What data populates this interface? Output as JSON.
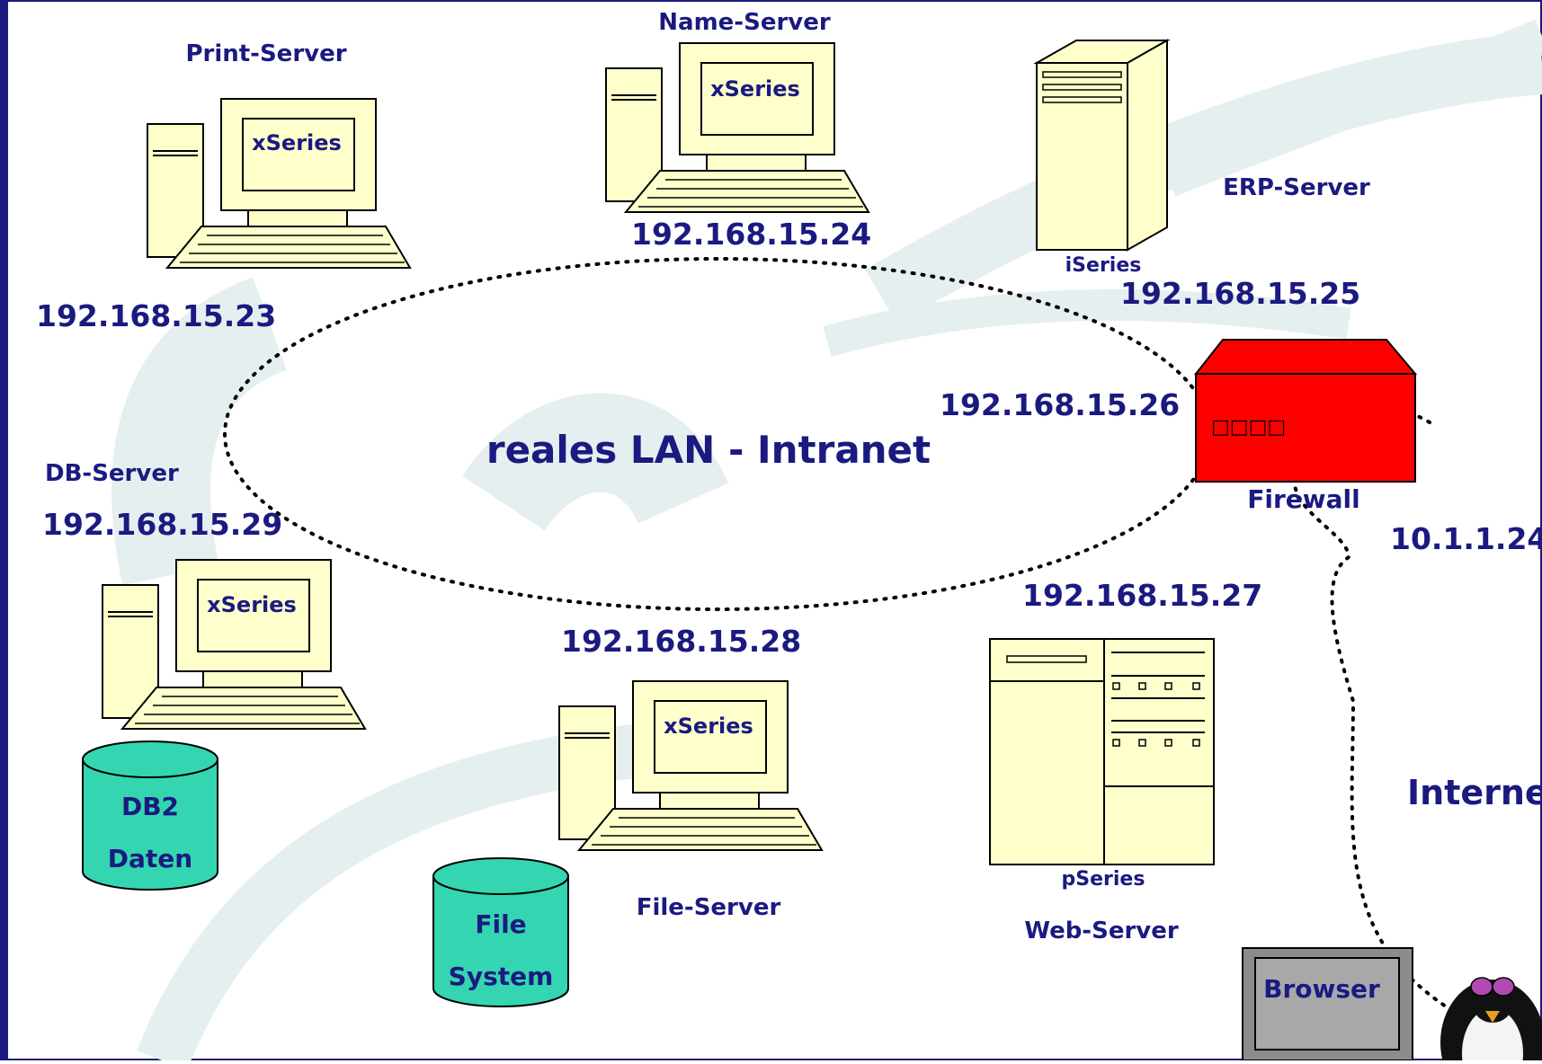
{
  "network": {
    "lan_label": "reales LAN - Intranet",
    "internet_label": "Interne",
    "external_ip": "10.1.1.24"
  },
  "nodes": {
    "print_server": {
      "role": "Print-Server",
      "series": "xSeries",
      "ip": "192.168.15.23"
    },
    "name_server": {
      "role": "Name-Server",
      "series": "xSeries",
      "ip": "192.168.15.24"
    },
    "erp_server": {
      "role": "ERP-Server",
      "series": "iSeries",
      "ip": "192.168.15.25"
    },
    "db_server": {
      "role": "DB-Server",
      "series": "xSeries",
      "ip": "192.168.15.29",
      "storage_line1": "DB2",
      "storage_line2": "Daten"
    },
    "file_server": {
      "role": "File-Server",
      "series": "xSeries",
      "ip": "192.168.15.28",
      "storage_line1": "File",
      "storage_line2": "System"
    },
    "web_server": {
      "role": "Web-Server",
      "series": "pSeries",
      "ip": "192.168.15.27"
    },
    "firewall": {
      "role": "Firewall",
      "ip": "192.168.15.26",
      "indicators": "□□□□"
    },
    "browser": {
      "label": "Browser"
    }
  },
  "colors": {
    "label": "#1a1a80",
    "computer_fill": "#ffffcc",
    "storage_fill": "#33d6b0",
    "firewall_fill": "#ff0000",
    "browser_fill": "#8c8c8c",
    "watermark": "#e3eeee",
    "border": "#1a1a80"
  }
}
